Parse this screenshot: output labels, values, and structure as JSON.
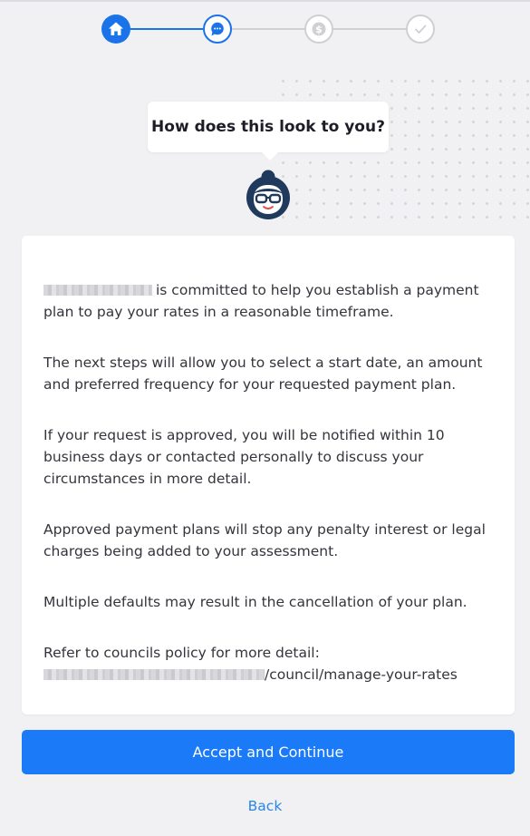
{
  "stepper": {
    "steps": [
      {
        "icon": "home-icon",
        "state": "completed"
      },
      {
        "icon": "chat-bubble-icon",
        "state": "current"
      },
      {
        "icon": "dollar-icon",
        "state": "upcoming"
      },
      {
        "icon": "checkmark-icon",
        "state": "upcoming"
      }
    ]
  },
  "bubble": {
    "text": "How does this look to you?"
  },
  "avatar": {
    "icon": "assistant-avatar-icon"
  },
  "card": {
    "p1": "is committed to help you establish a payment plan to pay your rates in a reasonable timeframe.",
    "p2": "The next steps will allow you to select a start date, an amount and preferred frequency for your requested payment plan.",
    "p3": "If your request is approved, you will be notified within 10 business days or contacted personally to discuss your circumstances in more detail.",
    "p4": "Approved payment plans will stop any penalty interest or legal charges being added to your assessment.",
    "p5": "Multiple defaults may result in the cancellation of your plan.",
    "p6_label": "Refer to councils policy for more detail:",
    "p6_link": "/council/manage-your-rates"
  },
  "actions": {
    "accept_label": "Accept and Continue",
    "back_label": "Back"
  },
  "colors": {
    "accent": "#1a73e8",
    "button": "#1a7af8",
    "link": "#2a86e8",
    "inactive": "#cfcfd4",
    "background": "#f1f1f3"
  }
}
